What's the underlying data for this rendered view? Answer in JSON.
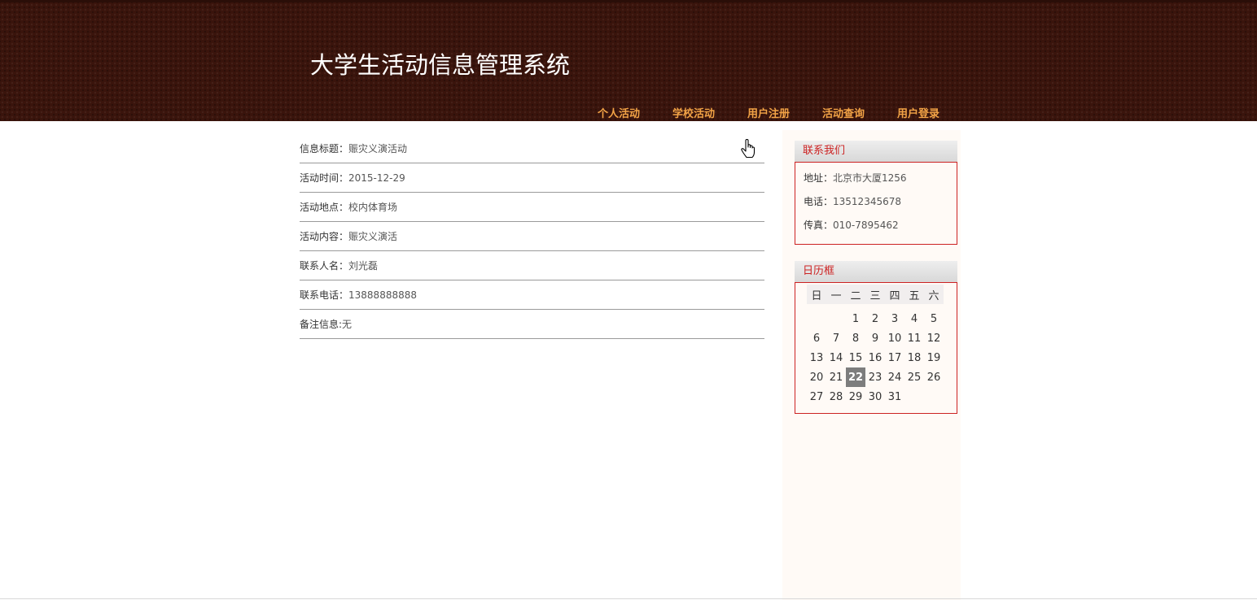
{
  "header": {
    "title": "大学生活动信息管理系统",
    "nav": [
      "个人活动",
      "学校活动",
      "用户注册",
      "活动查询",
      "用户登录"
    ]
  },
  "detail": [
    {
      "label": "信息标题：",
      "value": "赈灾义演活动"
    },
    {
      "label": "活动时间：",
      "value": "2015-12-29"
    },
    {
      "label": "活动地点：",
      "value": "校内体育场"
    },
    {
      "label": "活动内容：",
      "value": "赈灾义演活"
    },
    {
      "label": "联系人名：",
      "value": "刘光磊"
    },
    {
      "label": "联系电话：",
      "value": "13888888888"
    },
    {
      "label": "备注信息:",
      "value": "无"
    }
  ],
  "contact": {
    "title": "联系我们",
    "lines": [
      {
        "label": "地址：",
        "value": "北京市大厦1256"
      },
      {
        "label": "电话：",
        "value": "13512345678"
      },
      {
        "label": "传真：",
        "value": "010-7895462"
      }
    ]
  },
  "calendar": {
    "title": "日历框",
    "weekdays": [
      "日",
      "一",
      "二",
      "三",
      "四",
      "五",
      "六"
    ],
    "weeks": [
      [
        "",
        "",
        "",
        "1",
        "2",
        "3",
        "4",
        "5"
      ],
      [
        "6",
        "7",
        "8",
        "9",
        "10",
        "11",
        "12"
      ],
      [
        "13",
        "14",
        "15",
        "16",
        "17",
        "18",
        "19"
      ],
      [
        "20",
        "21",
        "22",
        "23",
        "24",
        "25",
        "26"
      ],
      [
        "27",
        "28",
        "29",
        "30",
        "31",
        "",
        ""
      ]
    ],
    "today": "22"
  }
}
